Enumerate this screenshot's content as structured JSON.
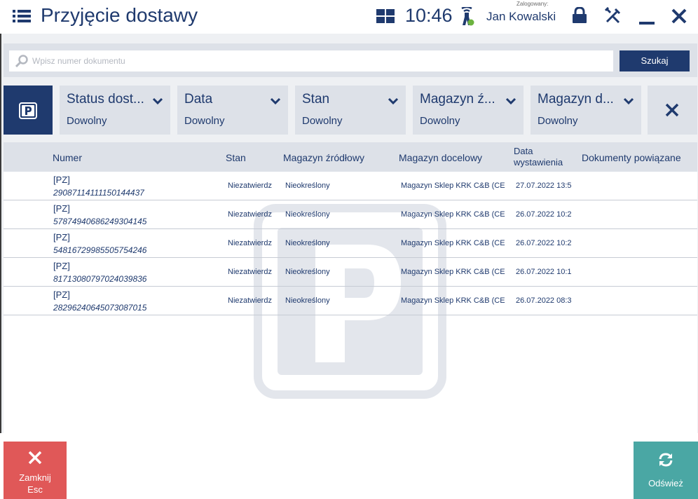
{
  "header": {
    "title": "Przyjęcie dostawy",
    "time": "10:46",
    "user_caption": "Zalogowany:",
    "user_name": "Jan Kowalski",
    "icons": [
      "menu-icon",
      "grid-icon",
      "signal-icon",
      "lock-icon",
      "tools-icon",
      "minimize-icon",
      "close-icon"
    ]
  },
  "search": {
    "placeholder": "Wpisz numer dokumentu",
    "value": "",
    "button_label": "Szukaj"
  },
  "filters": [
    {
      "label": "Status dost...",
      "value": "Dowolny"
    },
    {
      "label": "Data",
      "value": "Dowolny"
    },
    {
      "label": "Stan",
      "value": "Dowolny"
    },
    {
      "label": "Magazyn ź...",
      "value": "Dowolny"
    },
    {
      "label": "Magazyn d...",
      "value": "Dowolny"
    }
  ],
  "filter_type_icon": "p-icon",
  "table": {
    "columns": {
      "number": "Numer",
      "status": "Stan",
      "source": "Magazyn źródłowy",
      "target": "Magazyn docelowy",
      "date": "Data wystawienia",
      "related": "Dokumenty powiązane"
    },
    "rows": [
      {
        "type": "[PZ]",
        "number": "29087114111150144437",
        "status": "Niezatwierdz",
        "source": "Nieokreślony",
        "target": "Magazyn Sklep KRK C&B (CE",
        "date": "27.07.2022 13:5",
        "related": ""
      },
      {
        "type": "[PZ]",
        "number": "57874940686249304145",
        "status": "Niezatwierdz",
        "source": "Nieokreślony",
        "target": "Magazyn Sklep KRK C&B (CE",
        "date": "26.07.2022 10:2",
        "related": ""
      },
      {
        "type": "[PZ]",
        "number": "54816729985505754246",
        "status": "Niezatwierdz",
        "source": "Nieokreślony",
        "target": "Magazyn Sklep KRK C&B (CE",
        "date": "26.07.2022 10:2",
        "related": ""
      },
      {
        "type": "[PZ]",
        "number": "81713080797024039836",
        "status": "Niezatwierdz",
        "source": "Nieokreślony",
        "target": "Magazyn Sklep KRK C&B (CE",
        "date": "26.07.2022 10:1",
        "related": ""
      },
      {
        "type": "[PZ]",
        "number": "28296240645073087015",
        "status": "Niezatwierdz",
        "source": "Nieokreślony",
        "target": "Magazyn Sklep KRK C&B (CE",
        "date": "26.07.2022 08:3",
        "related": ""
      }
    ]
  },
  "footer": {
    "close_label_line1": "Zamknij",
    "close_label_line2": "Esc",
    "refresh_label": "Odśwież"
  },
  "colors": {
    "brand": "#1f3a6e",
    "panel": "#dde1e8",
    "close": "#e05858",
    "refresh": "#4aa7a4",
    "status_dot": "#6cb33f"
  }
}
